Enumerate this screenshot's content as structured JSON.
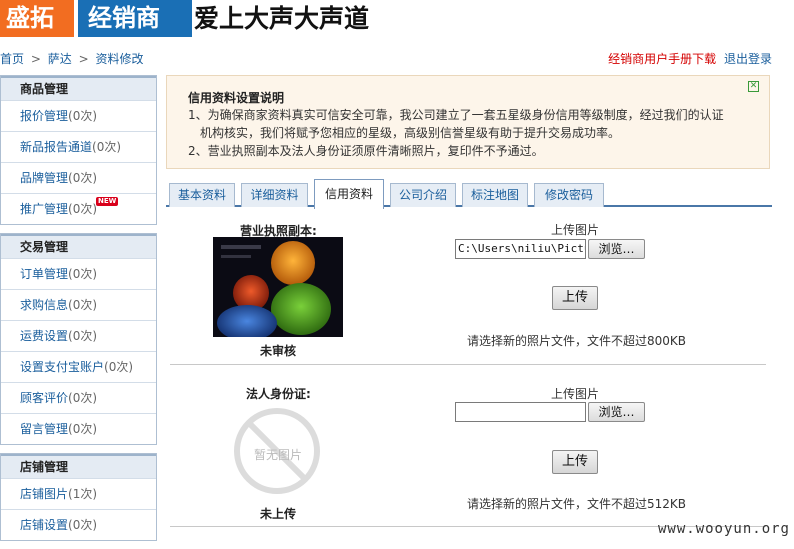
{
  "header": {
    "logo_part1": "盛拓",
    "logo_part2": "经销商",
    "shop_name": "爱上大声大声道"
  },
  "breadcrumb": {
    "items": [
      "首页",
      "萨达",
      "资料修改"
    ],
    "separator": ">"
  },
  "top_links": {
    "manual": "经销商用户手册下载",
    "logout": "退出登录"
  },
  "sidebar": {
    "groups": [
      {
        "title": "商品管理",
        "items": [
          {
            "label": "报价管理",
            "count": "(0次)"
          },
          {
            "label": "新品报告通道",
            "count": "(0次)"
          },
          {
            "label": "品牌管理",
            "count": "(0次)"
          },
          {
            "label": "推广管理",
            "count": "(0次)",
            "badge": "NEW"
          }
        ]
      },
      {
        "title": "交易管理",
        "items": [
          {
            "label": "订单管理",
            "count": "(0次)"
          },
          {
            "label": "求购信息",
            "count": "(0次)"
          },
          {
            "label": "运费设置",
            "count": "(0次)"
          },
          {
            "label": "设置支付宝账户",
            "count": "(0次)"
          },
          {
            "label": "顾客评价",
            "count": "(0次)"
          },
          {
            "label": "留言管理",
            "count": "(0次)"
          }
        ]
      },
      {
        "title": "店铺管理",
        "items": [
          {
            "label": "店铺图片",
            "count": "(1次)"
          },
          {
            "label": "店铺设置",
            "count": "(0次)"
          }
        ]
      }
    ]
  },
  "notice": {
    "title": "信用资料设置说明",
    "line1": "1、为确保商家资料真实可信安全可靠，我公司建立了一套五星级身份信用等级制度，经过我们的认证",
    "line1b": "机构核实，我们将赋予您相应的星级，高级别信誉星级有助于提升交易成功率。",
    "line2": "2、营业执照副本及法人身份证须原件清晰照片，复印件不予通过。",
    "close_icon": "close-icon"
  },
  "tabs": [
    {
      "label": "基本资料",
      "active": false
    },
    {
      "label": "详细资料",
      "active": false
    },
    {
      "label": "信用资料",
      "active": true
    },
    {
      "label": "公司介绍",
      "active": false
    },
    {
      "label": "标注地图",
      "active": false
    },
    {
      "label": "修改密码",
      "active": false
    }
  ],
  "sections": {
    "license": {
      "label": "营业执照副本:",
      "status": "未审核",
      "upload_label": "上传图片",
      "file_value": "C:\\Users\\niliu\\Pictur",
      "browse": "浏览…",
      "upload": "上传",
      "hint": "请选择新的照片文件，文件不超过800KB"
    },
    "id_card": {
      "label": "法人身份证:",
      "status": "未上传",
      "no_image": "暂无图片",
      "upload_label": "上传图片",
      "file_value": "",
      "browse": "浏览…",
      "upload": "上传",
      "hint": "请选择新的照片文件，文件不超过512KB"
    }
  },
  "watermark": "www.wooyun.org",
  "colors": {
    "logo_orange": "#f26d21",
    "logo_blue": "#1a6fb5",
    "link_blue": "#1a5e9c",
    "manual_red": "#d40000",
    "notice_bg": "#fdf5ea"
  }
}
